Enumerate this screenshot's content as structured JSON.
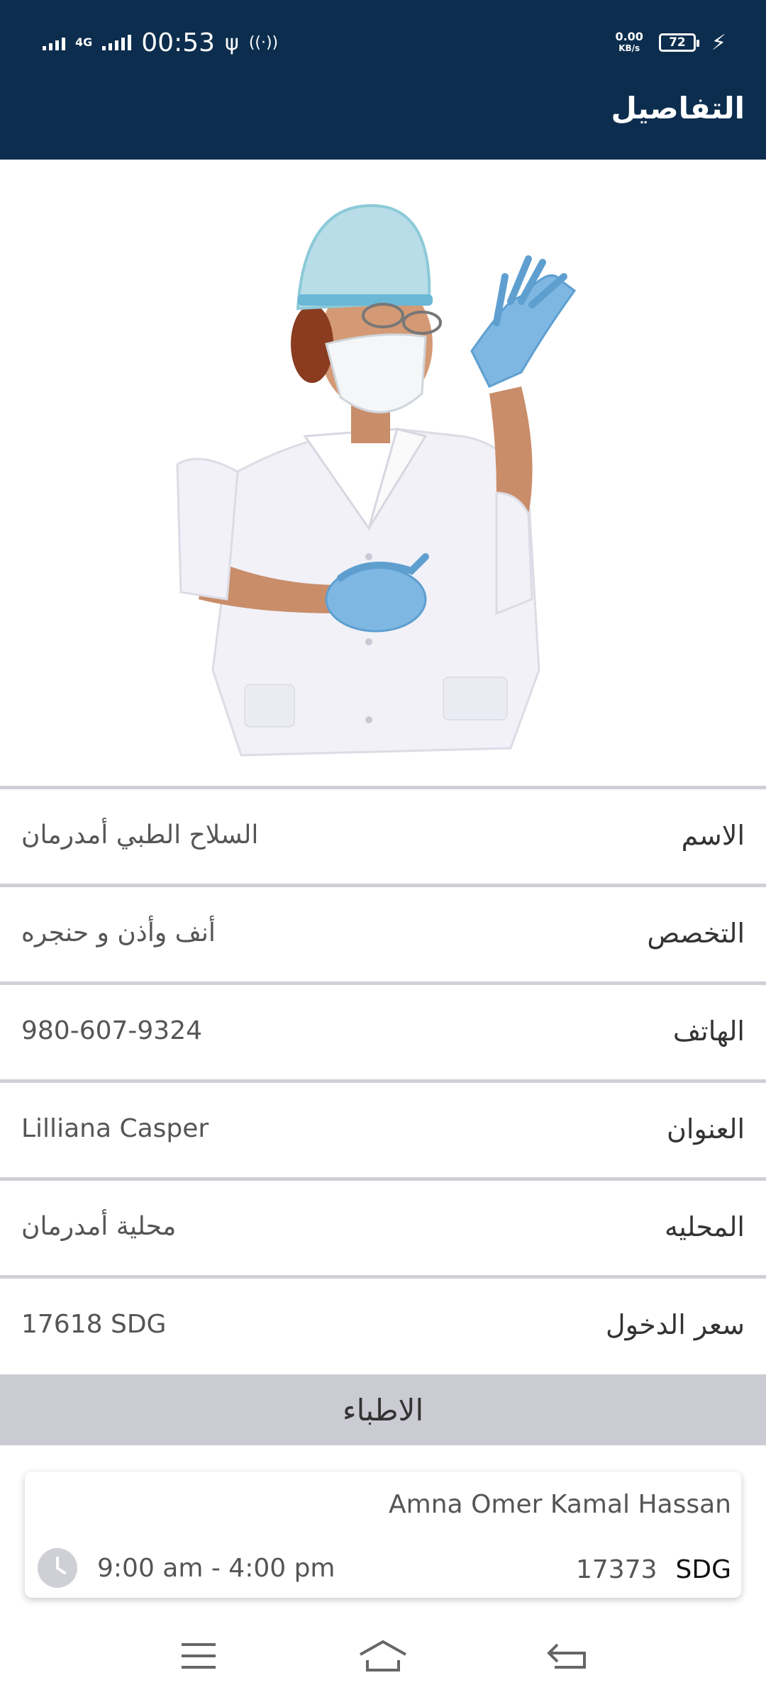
{
  "status_bar": {
    "time": "00:53",
    "network": "4G",
    "speed_value": "0.00",
    "speed_unit": "KB/s",
    "battery": "72"
  },
  "header": {
    "title": "التفاصيل"
  },
  "details": [
    {
      "label": "الاسم",
      "value": "السلاح الطبي أمدرمان"
    },
    {
      "label": "التخصص",
      "value": "أنف وأذن و حنجره"
    },
    {
      "label": "الهاتف",
      "value": "980-607-9324"
    },
    {
      "label": "العنوان",
      "value": "Lilliana Casper"
    },
    {
      "label": "المحليه",
      "value": "محلية أمدرمان"
    },
    {
      "label": "سعر الدخول",
      "value": "17618 SDG"
    }
  ],
  "doctors_section": {
    "title": "الاطباء"
  },
  "doctor_card": {
    "names": "Amna Omer  Kamal Hassan",
    "hours": "9:00 am - 4:00 pm",
    "price": "17373",
    "currency": "SDG"
  },
  "colors": {
    "header_bg": "#0c2d4e",
    "section_bg": "#cbcbd3",
    "divider": "#cfcfd6"
  }
}
